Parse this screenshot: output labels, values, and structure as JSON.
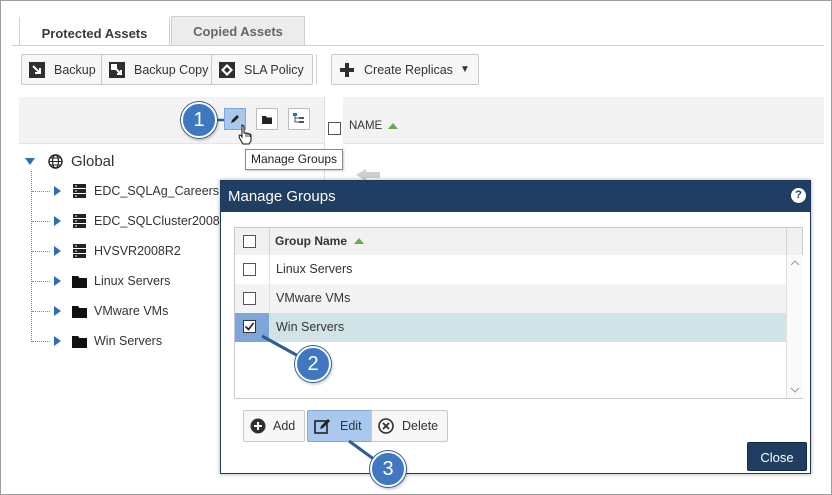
{
  "tabs": [
    {
      "label": "Protected Assets",
      "active": true
    },
    {
      "label": "Copied Assets",
      "active": false
    }
  ],
  "toolbar": {
    "backup": "Backup",
    "backup_copy": "Backup Copy",
    "sla_policy": "SLA Policy",
    "create_replicas": "Create Replicas",
    "dropdown_glyph": "▼"
  },
  "tree": {
    "root": "Global",
    "items": [
      {
        "label": "EDC_SQLAg_Careers",
        "icon": "server-icon"
      },
      {
        "label": "EDC_SQLCluster2008",
        "icon": "server-icon"
      },
      {
        "label": "HVSVR2008R2",
        "icon": "server-icon"
      },
      {
        "label": "Linux Servers",
        "icon": "folder-icon"
      },
      {
        "label": "VMware VMs",
        "icon": "folder-icon"
      },
      {
        "label": "Win Servers",
        "icon": "folder-icon"
      }
    ]
  },
  "list": {
    "name_header": "NAME"
  },
  "tooltip": "Manage Groups",
  "dialog": {
    "title": "Manage Groups",
    "help_glyph": "?",
    "column_header": "Group Name",
    "rows": [
      {
        "name": "Linux Servers",
        "checked": false
      },
      {
        "name": "VMware VMs",
        "checked": false
      },
      {
        "name": "Win Servers",
        "checked": true
      }
    ],
    "add": "Add",
    "edit": "Edit",
    "delete": "Delete",
    "close": "Close"
  },
  "callouts": [
    "1",
    "2",
    "3"
  ],
  "colors": {
    "dialog_title": "#1f3e62",
    "selected_row": "#d2e3e8",
    "selected_button": "#a9c8ee",
    "callout": "#3f78c0",
    "tree_arrow": "#2a6eb5"
  }
}
